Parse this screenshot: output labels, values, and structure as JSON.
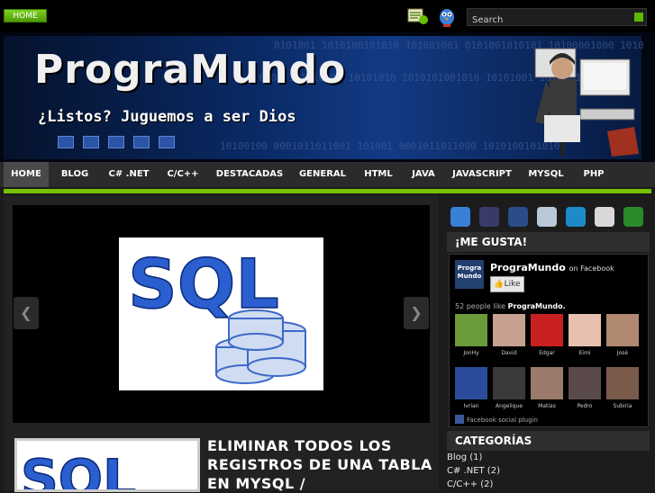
{
  "topbar": {
    "home_label": "HOME",
    "search_placeholder": "Search"
  },
  "banner": {
    "logo": "PrograMundo",
    "slogan": "¿Listos? Juguemos a ser Dios",
    "binary_lines": [
      "0101001 1010100101010 101001001 0101001010101 10100001000 1010",
      "010101 101010100 10101010 1010101001010 10101001 10100010",
      "10100100 0001011011001 101001 0001011011000 10101001010101"
    ]
  },
  "nav": {
    "items": [
      "HOME",
      "BLOG",
      "C# .NET",
      "C/C++",
      "DESTACADAS",
      "GENERAL",
      "HTML",
      "JAVA",
      "JAVASCRIPT",
      "MYSQL",
      "PHP"
    ]
  },
  "slider": {
    "image_text": "SQL",
    "prev": "❮",
    "next": "❯"
  },
  "post": {
    "title": "ELIMINAR TODOS LOS REGISTROS DE UNA TABLA EN MYSQL /",
    "thumb_text": "SQL"
  },
  "social_icons": [
    "twitter-icon",
    "delicious-icon",
    "facebook-icon",
    "digg-icon",
    "stumbleupon-icon",
    "favorites-icon",
    "share-icon"
  ],
  "like_widget": {
    "heading": "¡ME GUSTA!",
    "page_name": "PrograMundo",
    "on_facebook": "on Facebook",
    "logo_text": "Progra Mundo",
    "like_button": "Like",
    "count_prefix": "52 people like",
    "count_page": "PrograMundo.",
    "fans": [
      "JonHy",
      "David",
      "Edgar",
      "Eimi",
      "José",
      "Ivrian",
      "Angelique",
      "Matias",
      "Pedro",
      "Subiria"
    ],
    "footer": "Facebook social plugin"
  },
  "categories": {
    "heading": "CATEGORÍAS",
    "items": [
      "Blog (1)",
      "C# .NET (2)",
      "C/C++ (2)"
    ]
  },
  "colors": {
    "accent_green": "#76c000",
    "facebook_blue": "#3b5998"
  }
}
